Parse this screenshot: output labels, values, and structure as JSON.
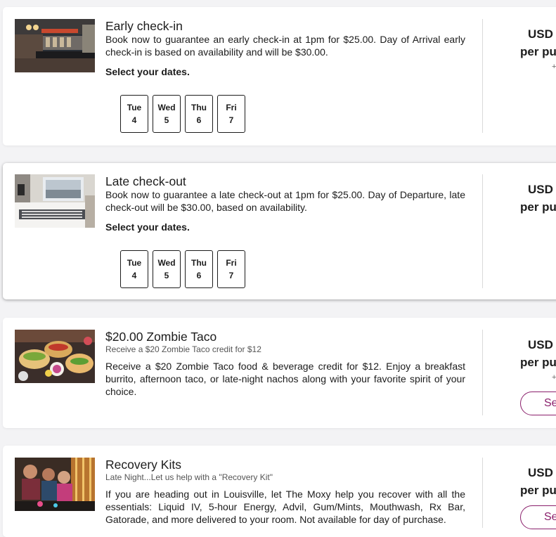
{
  "cards": [
    {
      "title": "Early check-in",
      "description": "Book now to guarantee an early check-in at 1pm for $25.00. Day of Arrival early check-in is based on availability and will be $30.00.",
      "select_label": "Select your dates.",
      "dates": [
        {
          "day": "Tue",
          "num": "4"
        },
        {
          "day": "Wed",
          "num": "5"
        },
        {
          "day": "Thu",
          "num": "6"
        },
        {
          "day": "Fri",
          "num": "7"
        }
      ],
      "price_line1": "USD",
      "price_line2": "per pu",
      "plus": "+",
      "image": "hotel-lobby-bar-photo"
    },
    {
      "title": "Late check-out",
      "description": "Book now to guarantee a late check-out at 1pm for $25.00. Day of Departure, late check-out will be $30.00, based on availability.",
      "select_label": "Select your dates.",
      "dates": [
        {
          "day": "Tue",
          "num": "4"
        },
        {
          "day": "Wed",
          "num": "5"
        },
        {
          "day": "Thu",
          "num": "6"
        },
        {
          "day": "Fri",
          "num": "7"
        }
      ],
      "price_line1": "USD",
      "price_line2": "per pu",
      "image": "hotel-bedroom-photo"
    },
    {
      "title": "$20.00 Zombie Taco",
      "subtitle": "Receive a $20 Zombie Taco credit for $12",
      "description": "Receive a $20 Zombie Taco food & beverage credit for $12. Enjoy a breakfast burrito, afternoon taco, or late-night nachos along with your favorite spirit of your choice.",
      "price_line1": "USD",
      "price_line2": "per pu",
      "plus": "+",
      "button_label": "Se",
      "image": "tacos-food-photo"
    },
    {
      "title": "Recovery Kits",
      "subtitle": "Late Night...Let us help with a \"Recovery Kit\"",
      "description": "If you are heading out in Louisville, let The Moxy help you recover with all the essentials: Liquid IV, 5-hour Energy, Advil, Gum/Mints, Mouthwash, Rx Bar, Gatorade, and more delivered to your room. Not available for day of purchase.",
      "price_line1": "USD",
      "price_line2": "per pu",
      "button_label": "Se",
      "image": "friends-night-out-photo"
    }
  ]
}
